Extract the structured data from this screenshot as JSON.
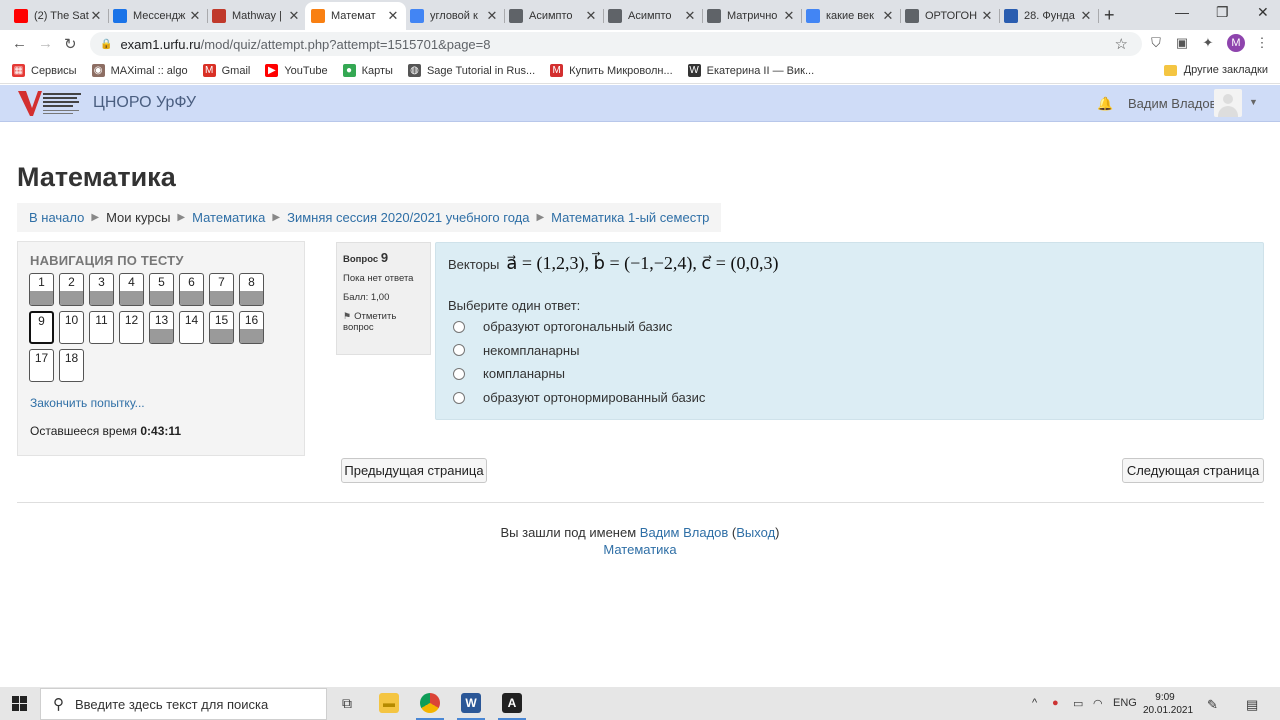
{
  "browser": {
    "tabs": [
      {
        "title": "(2) The Sat",
        "icon": "youtube-icon",
        "color": "#ff0000"
      },
      {
        "title": "Мессендж",
        "icon": "messenger-icon",
        "color": "#1a73e8"
      },
      {
        "title": "Mathway |",
        "icon": "mathway-icon",
        "color": "#c0392b"
      },
      {
        "title": "Математ",
        "icon": "moodle-icon",
        "color": "#f98012"
      },
      {
        "title": "угловой к",
        "icon": "google-icon",
        "color": "#4285f4"
      },
      {
        "title": "Асимпто",
        "icon": "globe-icon",
        "color": "#5f6368"
      },
      {
        "title": "Асимпто",
        "icon": "page-icon",
        "color": "#5f6368"
      },
      {
        "title": "Матрично",
        "icon": "doc-icon",
        "color": "#5f6368"
      },
      {
        "title": "какие век",
        "icon": "google-icon",
        "color": "#4285f4"
      },
      {
        "title": "ОРТОГОН",
        "icon": "globe-icon",
        "color": "#5f6368"
      },
      {
        "title": "28. Фунда",
        "icon": "d-icon",
        "color": "#2a5db0"
      }
    ],
    "url_host": "exam1.urfu.ru",
    "url_rest": "/mod/quiz/attempt.php?attempt=1515701&page=8",
    "profile_letter": "M",
    "bookmarks": [
      {
        "label": "Сервисы",
        "color": "#e53935",
        "glyph": "▦"
      },
      {
        "label": "MAXimal :: algo",
        "color": "#8d6e63",
        "glyph": "◉"
      },
      {
        "label": "Gmail",
        "color": "#d93025",
        "glyph": "M"
      },
      {
        "label": "YouTube",
        "color": "#ff0000",
        "glyph": "▶"
      },
      {
        "label": "Карты",
        "color": "#34a853",
        "glyph": "●"
      },
      {
        "label": "Sage Tutorial in Rus...",
        "color": "#555555",
        "glyph": "◍"
      },
      {
        "label": "Купить Микроволн...",
        "color": "#d32f2f",
        "glyph": "M"
      },
      {
        "label": "Екатерина II — Вик...",
        "color": "#333333",
        "glyph": "W"
      }
    ],
    "other_bookmarks": "Другие закладки"
  },
  "site": {
    "name": "ЦНОРО УрФУ",
    "user": "Вадим Владов"
  },
  "page": {
    "title": "Математика",
    "breadcrumb": [
      "В начало",
      "Мои курсы",
      "Математика",
      "Зимняя сессия 2020/2021 учебного года",
      "Математика 1-ый семестр"
    ]
  },
  "quiz_nav": {
    "title": "НАВИГАЦИЯ ПО ТЕСТУ",
    "questions": [
      {
        "n": "1",
        "answered": true
      },
      {
        "n": "2",
        "answered": true
      },
      {
        "n": "3",
        "answered": true
      },
      {
        "n": "4",
        "answered": true
      },
      {
        "n": "5",
        "answered": true
      },
      {
        "n": "6",
        "answered": true
      },
      {
        "n": "7",
        "answered": true
      },
      {
        "n": "8",
        "answered": true
      },
      {
        "n": "9",
        "answered": false,
        "current": true
      },
      {
        "n": "10",
        "answered": false
      },
      {
        "n": "11",
        "answered": false
      },
      {
        "n": "12",
        "answered": false
      },
      {
        "n": "13",
        "answered": true
      },
      {
        "n": "14",
        "answered": false
      },
      {
        "n": "15",
        "answered": true
      },
      {
        "n": "16",
        "answered": true
      },
      {
        "n": "17",
        "answered": false
      },
      {
        "n": "18",
        "answered": false
      }
    ],
    "finish_link": "Закончить попытку...",
    "time_label": "Оставшееся время",
    "time_value": "0:43:11"
  },
  "question": {
    "label": "Вопрос",
    "number": "9",
    "status": "Пока нет ответа",
    "grade": "Балл: 1,00",
    "flag": "Отметить вопрос",
    "lead": "Векторы",
    "formula": "a⃗ = (1,2,3), b⃗ = (−1,−2,4), c⃗ = (0,0,3)",
    "prompt": "Выберите один ответ:",
    "options": [
      "образуют ортогональный базис",
      "некомпланарны",
      "компланарны",
      "образуют ортонормированный базис"
    ]
  },
  "buttons": {
    "prev": "Предыдущая страница",
    "next": "Следующая страница"
  },
  "footer": {
    "logged_in": "Вы зашли под именем",
    "user": "Вадим Владов",
    "logout": "Выход",
    "course": "Математика"
  },
  "taskbar": {
    "search_placeholder": "Введите здесь текст для поиска",
    "lang": "ENG",
    "time": "9:09",
    "date": "20.01.2021"
  }
}
